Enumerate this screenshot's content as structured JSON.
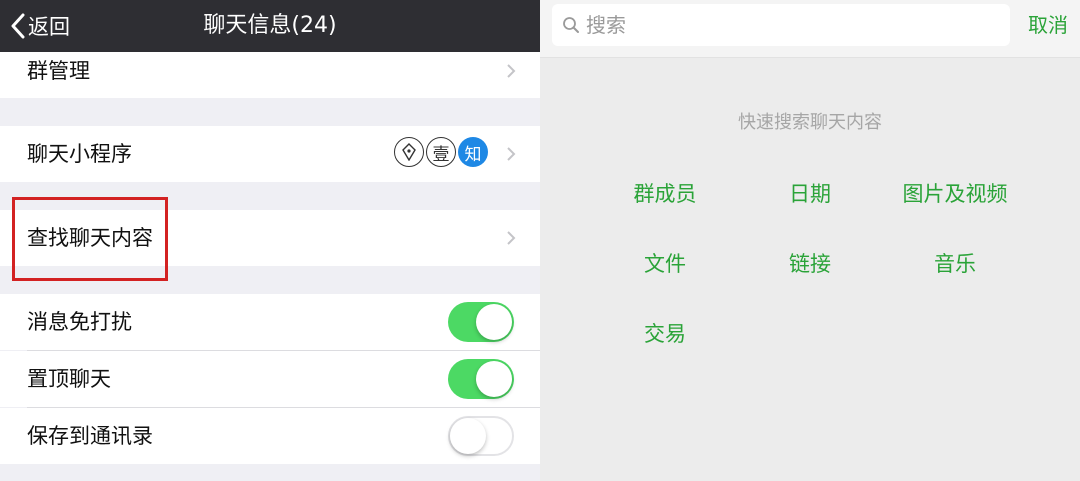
{
  "left": {
    "back_label": "返回",
    "title": "聊天信息(24)",
    "rows": {
      "group_manage": "群管理",
      "mini_programs": "聊天小程序",
      "find_content": "查找聊天内容",
      "mute": "消息免打扰",
      "pin": "置顶聊天",
      "save_contacts": "保存到通讯录"
    },
    "mini_icons": [
      "",
      "壹",
      "知"
    ],
    "toggles": {
      "mute": true,
      "pin": true,
      "save_contacts": false
    }
  },
  "right": {
    "search_placeholder": "搜索",
    "cancel_label": "取消",
    "hint": "快速搜索聊天内容",
    "options": [
      "群成员",
      "日期",
      "图片及视频",
      "文件",
      "链接",
      "音乐",
      "交易"
    ]
  },
  "colors": {
    "accent_green": "#2aa338",
    "toggle_on": "#4cd964",
    "navbar": "#2e2e33",
    "highlight": "#d32222",
    "badge_blue": "#1e88e5"
  },
  "icons": [
    "back-chevron-icon",
    "chevron-right-icon",
    "pen-nib-icon",
    "search-icon"
  ]
}
